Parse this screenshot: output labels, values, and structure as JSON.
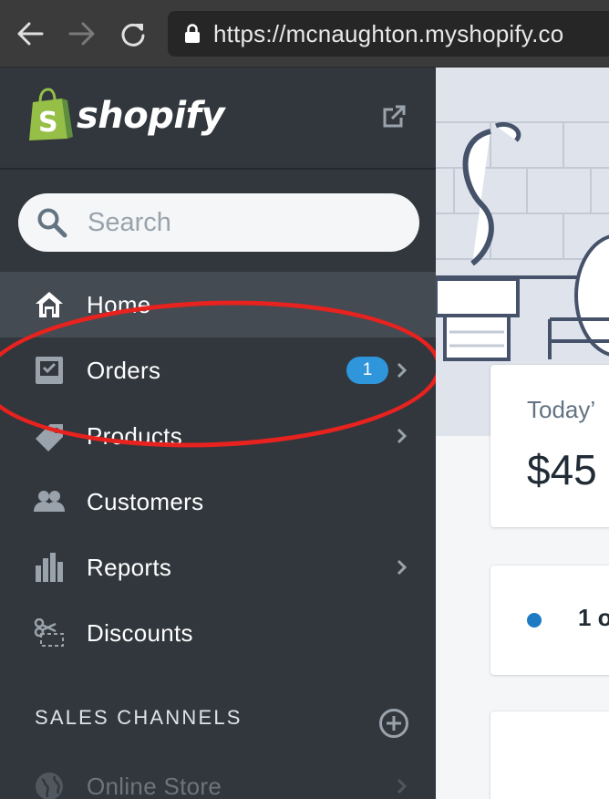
{
  "browser": {
    "url_scheme": "https://",
    "url_host": "mcnaughton.myshopify.co"
  },
  "brand": {
    "name": "shopify",
    "colors": {
      "bag_green": "#95bf47",
      "bag_dark": "#5e8e3e",
      "badge_blue": "#2f96dc",
      "sidebar_bg": "#31373d",
      "active_bg": "#444b53",
      "annotation_red": "#e8221e"
    }
  },
  "search": {
    "placeholder": "Search",
    "icon": "search-icon"
  },
  "nav": [
    {
      "label": "Home",
      "icon": "home-icon",
      "active": true,
      "chevron": false
    },
    {
      "label": "Orders",
      "icon": "orders-icon",
      "active": false,
      "chevron": true,
      "badge": "1"
    },
    {
      "label": "Products",
      "icon": "tag-icon",
      "active": false,
      "chevron": true
    },
    {
      "label": "Customers",
      "icon": "customers-icon",
      "active": false,
      "chevron": false
    },
    {
      "label": "Reports",
      "icon": "bar-chart-icon",
      "active": false,
      "chevron": true
    },
    {
      "label": "Discounts",
      "icon": "discount-icon",
      "active": false,
      "chevron": false
    }
  ],
  "sales_channels": {
    "heading": "SALES CHANNELS",
    "items": [
      {
        "label": "Online Store",
        "icon": "globe-icon",
        "chevron": true
      }
    ]
  },
  "main": {
    "card1": {
      "label": "Today’",
      "value": "$45"
    },
    "card2": {
      "text": "1 o"
    }
  }
}
